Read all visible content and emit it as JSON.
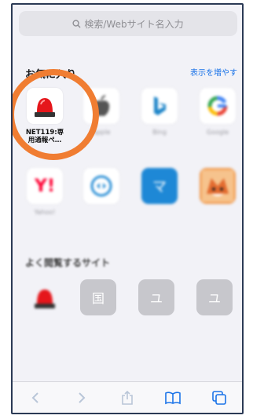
{
  "search": {
    "placeholder": "検索/Webサイト名入力"
  },
  "favorites": {
    "title": "お気に入り",
    "more_link": "表示を増やす",
    "items": [
      {
        "label": "NET119:専\n用通報ペ…",
        "icon": "siren-icon"
      },
      {
        "label": "Apple",
        "icon": "apple-icon"
      },
      {
        "label": "Bing",
        "icon": "bing-icon"
      },
      {
        "label": "Google",
        "icon": "google-icon"
      },
      {
        "label": "Yahoo!",
        "icon": "yahoo-icon"
      },
      {
        "label": "",
        "icon": "arrows-icon"
      },
      {
        "label": "",
        "icon": "blue-square-icon"
      },
      {
        "label": "",
        "icon": "fox-icon"
      }
    ]
  },
  "frequent": {
    "title": "よく閲覧するサイト",
    "items": [
      {
        "label": "",
        "icon": "siren-icon"
      },
      {
        "label": "",
        "glyph": "国"
      },
      {
        "label": "",
        "glyph": "ユ"
      },
      {
        "label": "",
        "glyph": "ユ"
      }
    ]
  },
  "colors": {
    "accent": "#1a73e8",
    "highlight_circle": "#f07d32",
    "frame": "#2b3a55"
  }
}
